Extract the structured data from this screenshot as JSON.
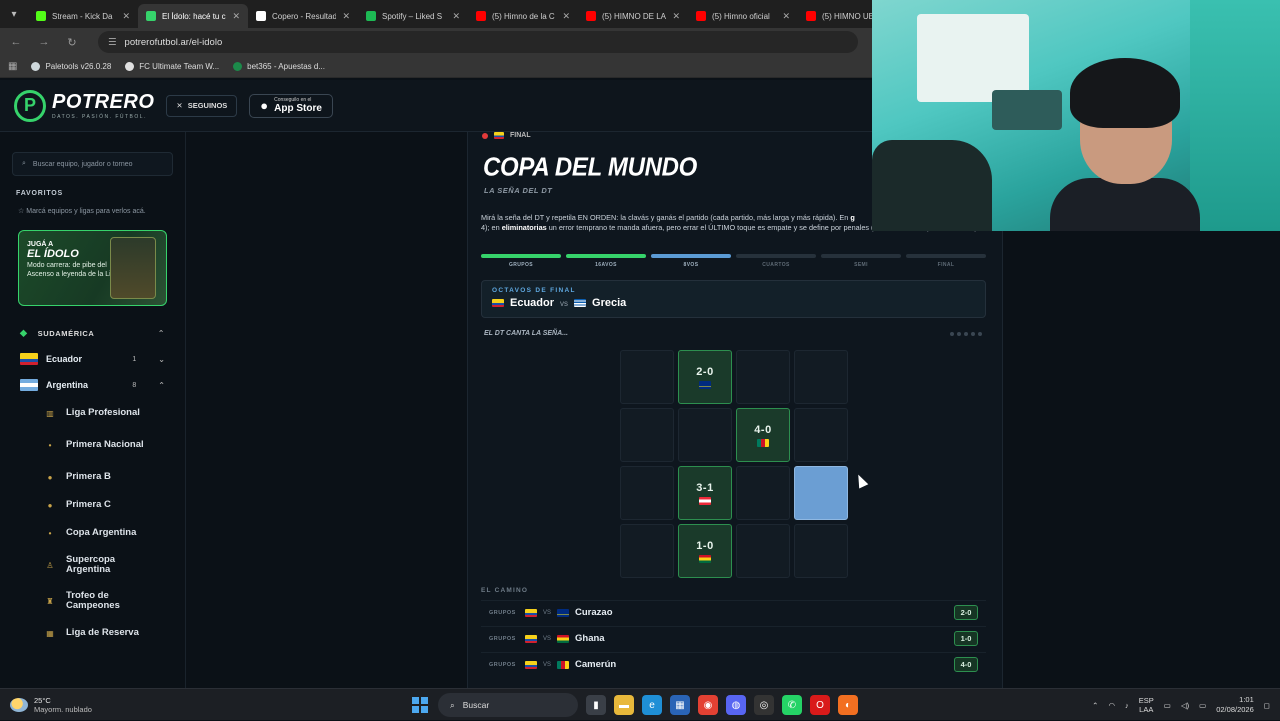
{
  "browser": {
    "tabs": [
      {
        "title": "Stream - Kick Da",
        "color": "#53fc18",
        "active": false
      },
      {
        "title": "El Ídolo: hacé tu c",
        "color": "#36d36b",
        "active": true
      },
      {
        "title": "Copero - Resultad",
        "color": "#ffffff",
        "active": false
      },
      {
        "title": "Spotify – Liked S",
        "color": "#1db954",
        "active": false
      },
      {
        "title": "(5) Himno de la C",
        "color": "#ff0000",
        "active": false
      },
      {
        "title": "(5) HIMNO DE LA",
        "color": "#ff0000",
        "active": false
      },
      {
        "title": "(5) Himno oficial",
        "color": "#ff0000",
        "active": false
      },
      {
        "title": "(5) HIMNO UEF",
        "color": "#ff0000",
        "active": false
      }
    ],
    "url": "potrerofutbol.ar/el-idolo",
    "bookmarks": [
      {
        "label": "Paletools v26.0.28",
        "color": "#cfd8dc"
      },
      {
        "label": "FC Ultimate Team W...",
        "color": "#e0e0e0"
      },
      {
        "label": "bet365 - Apuestas d...",
        "color": "#1c8a4a"
      }
    ]
  },
  "header": {
    "logo_name": "POTRERO",
    "logo_tag": "DATOS. PASIÓN. FÚTBOL.",
    "follow_label": "SEGUINOS",
    "appstore_small": "Conseguilo en el",
    "appstore_big": "App Store"
  },
  "sidebar": {
    "search_placeholder": "Buscar equipo, jugador o torneo",
    "favorites_title": "FAVORITOS",
    "favorites_hint": "Marcá equipos y ligas para verlos acá.",
    "promo": {
      "line1": "JUGÁ A",
      "line2": "EL ÍDOLO",
      "line3": "Modo carrera: de pibe del Ascenso a leyenda de la Liga"
    },
    "region": "SUDAMÉRICA",
    "countries": [
      {
        "name": "Ecuador",
        "count": "1"
      },
      {
        "name": "Argentina",
        "count": "8"
      }
    ],
    "leagues": [
      "Liga Profesional",
      "Primera Nacional",
      "Primera B",
      "Primera C",
      "Copa Argentina",
      "Supercopa Argentina",
      "Trofeo de Campeones",
      "Liga de Reserva"
    ]
  },
  "main": {
    "crumb": "FINAL",
    "title": "COPA DEL MUNDO",
    "subtitle": "LA SEÑA DEL DT",
    "desc_1": "Mirá la seña del DT y repetila EN ORDEN: la clavás y ganás el partido (cada partido, más larga y más rápida). En ",
    "desc_2": "g",
    "desc_3": "4); en ",
    "desc_4": "eliminatorias",
    "desc_5": " un error temprano te manda afuera, pero errar el ÚLTIMO toque es empate y se define por penales (una seña sola a pura velocidad).",
    "progress": [
      {
        "label": "GRUPOS",
        "state": "done"
      },
      {
        "label": "16AVOS",
        "state": "done"
      },
      {
        "label": "8VOS",
        "state": "current"
      },
      {
        "label": "CUARTOS",
        "state": "pending"
      },
      {
        "label": "SEMI",
        "state": "pending"
      },
      {
        "label": "FINAL",
        "state": "pending"
      }
    ],
    "match": {
      "stage": "OCTAVOS DE FINAL",
      "home": "Ecuador",
      "vs": "vs",
      "away": "Grecia"
    },
    "sign_title": "EL DT CANTA LA SEÑA...",
    "grid": [
      {
        "state": "empty"
      },
      {
        "state": "hit",
        "score": "2-0",
        "flag": "cw"
      },
      {
        "state": "empty"
      },
      {
        "state": "empty"
      },
      {
        "state": "empty"
      },
      {
        "state": "empty"
      },
      {
        "state": "hit",
        "score": "4-0",
        "flag": "cm"
      },
      {
        "state": "empty"
      },
      {
        "state": "empty"
      },
      {
        "state": "hit",
        "score": "3-1",
        "flag": "at"
      },
      {
        "state": "empty"
      },
      {
        "state": "active"
      },
      {
        "state": "empty"
      },
      {
        "state": "hit",
        "score": "1-0",
        "flag": "gh"
      },
      {
        "state": "empty"
      },
      {
        "state": "empty"
      }
    ],
    "camino_title": "EL CAMINO",
    "path": [
      {
        "stage": "GRUPOS",
        "vs": "VS",
        "opponent": "Curazao",
        "flag": "cw",
        "score": "2-0"
      },
      {
        "stage": "GRUPOS",
        "vs": "VS",
        "opponent": "Ghana",
        "flag": "gh",
        "score": "1-0"
      },
      {
        "stage": "GRUPOS",
        "vs": "VS",
        "opponent": "Camerún",
        "flag": "cm",
        "score": "4-0"
      }
    ]
  },
  "taskbar": {
    "temp": "25°C",
    "weather": "Mayorm. nublado",
    "search": "Buscar",
    "lang_1": "ESP",
    "lang_2": "LAA",
    "time": "1:01",
    "date": "02/08/2026"
  }
}
